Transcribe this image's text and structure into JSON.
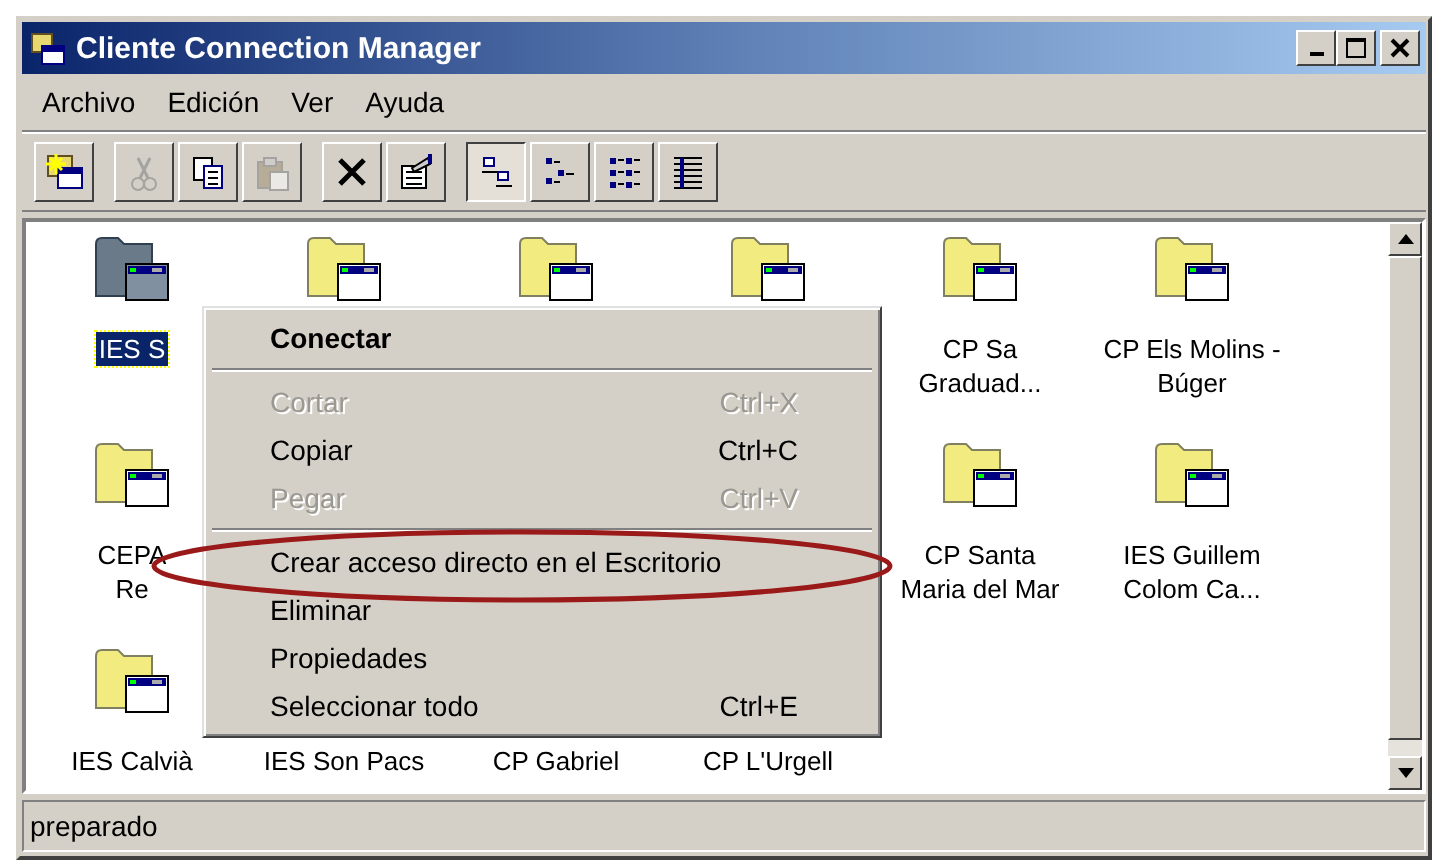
{
  "window": {
    "title": "Cliente Connection Manager"
  },
  "menu_bar": [
    {
      "label": "Archivo"
    },
    {
      "label": "Edición"
    },
    {
      "label": "Ver"
    },
    {
      "label": "Ayuda"
    }
  ],
  "toolbar": [
    {
      "kind": "new",
      "disabled": false,
      "selected": false
    },
    {
      "kind": "cut",
      "disabled": true,
      "selected": false
    },
    {
      "kind": "copy",
      "disabled": false,
      "selected": false
    },
    {
      "kind": "paste",
      "disabled": true,
      "selected": false
    },
    {
      "kind": "delete",
      "disabled": false,
      "selected": false
    },
    {
      "kind": "properties",
      "disabled": false,
      "selected": false
    },
    {
      "kind": "large-icons",
      "disabled": false,
      "selected": true
    },
    {
      "kind": "small-icons",
      "disabled": false,
      "selected": false
    },
    {
      "kind": "list",
      "disabled": false,
      "selected": false
    },
    {
      "kind": "details",
      "disabled": false,
      "selected": false
    }
  ],
  "connections": [
    {
      "lines": [
        "IES S"
      ],
      "selected": true
    },
    {
      "selected": false
    },
    {
      "selected": false
    },
    {
      "selected": false
    },
    {
      "lines": [
        "CP Sa",
        "Graduad..."
      ],
      "selected": false
    },
    {
      "lines": [
        "CP Els Molins -",
        "Búger"
      ],
      "selected": false
    },
    {
      "lines": [
        "CEPA",
        "Re"
      ],
      "selected": false
    },
    {
      "lines": [
        "CP Santa",
        "Maria del Mar"
      ],
      "selected": false
    },
    {
      "lines": [
        "IES Guillem",
        "Colom Ca..."
      ],
      "selected": false
    },
    {
      "lines": [
        "IES Calvià"
      ],
      "selected": false
    },
    {
      "lines": [
        "IES Son Pacs"
      ],
      "selected": false
    },
    {
      "lines": [
        "CP Gabriel"
      ],
      "selected": false
    },
    {
      "lines": [
        "CP L'Urgell"
      ],
      "selected": false
    }
  ],
  "context_menu": [
    {
      "kind": "item",
      "label": "Conectar",
      "default": true,
      "disabled": false
    },
    {
      "kind": "separator"
    },
    {
      "kind": "item",
      "label": "Cortar",
      "shortcut": "Ctrl+X",
      "default": false,
      "disabled": true
    },
    {
      "kind": "item",
      "label": "Copiar",
      "shortcut": "Ctrl+C",
      "default": false,
      "disabled": false
    },
    {
      "kind": "item",
      "label": "Pegar",
      "shortcut": "Ctrl+V",
      "default": false,
      "disabled": true
    },
    {
      "kind": "separator"
    },
    {
      "kind": "item",
      "label": "Crear acceso directo en el Escritorio",
      "default": false,
      "disabled": false
    },
    {
      "kind": "item",
      "label": "Eliminar",
      "default": false,
      "disabled": false
    },
    {
      "kind": "item",
      "label": "Propiedades",
      "default": false,
      "disabled": false
    },
    {
      "kind": "item",
      "label": "Seleccionar todo",
      "shortcut": "Ctrl+E",
      "default": false,
      "disabled": false
    }
  ],
  "status_bar": {
    "text": "preparado"
  }
}
